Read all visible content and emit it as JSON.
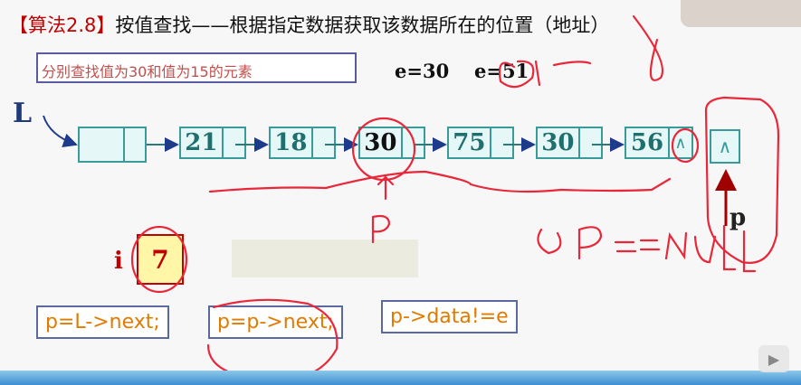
{
  "title": {
    "bracket_label": "【算法2.8】",
    "text": "按值查找——根据指定数据获取该数据所在的位置（地址）"
  },
  "subtitle": "分别查找值为30和值为15的元素",
  "e_values": {
    "e1": "e=30",
    "e2": "e=51"
  },
  "list_label": "L",
  "nodes": [
    "21",
    "18",
    "30",
    "75",
    "30",
    "56"
  ],
  "null_symbol": "∧",
  "pointer_label": "p",
  "index": {
    "label": "i",
    "value": "7"
  },
  "code": [
    "p=L->next;",
    "p=p->next;",
    "p->data!=e"
  ],
  "annotations": {
    "p_mark": "P",
    "null_condition": "① P==NULL",
    "fifteen": "15"
  },
  "colors": {
    "node_border": "#3a9a9a",
    "node_fill": "#e6f7f7",
    "accent_red": "#c00000",
    "ink": "#e8283a",
    "code_text": "#e07b00"
  }
}
